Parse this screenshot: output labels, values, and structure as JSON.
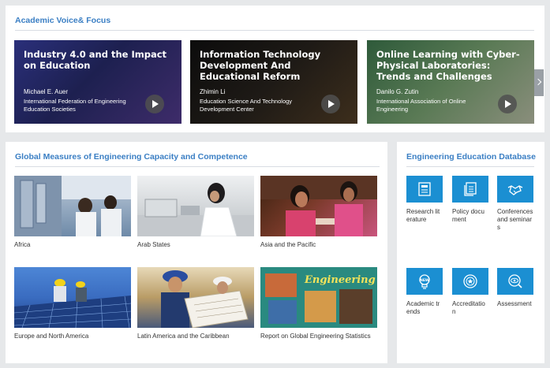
{
  "academic": {
    "title": "Academic Voice& Focus",
    "cards": [
      {
        "title": "Industry 4.0 and the Impact on Education",
        "author": "Michael E. Auer",
        "org": "International Federation of Engineering Education Societies"
      },
      {
        "title": "Information Technology Development And Educational Reform",
        "author": "Zhimin Li",
        "org": "Education Science And Technology Development Center"
      },
      {
        "title": "Online Learning with Cyber-Physical Laboratories: Trends and Challenges",
        "author": "Danilo G. Zutin",
        "org": "International Association of Online Engineering"
      }
    ]
  },
  "measures": {
    "title": "Global Measures of Engineering Capacity and Competence",
    "items": [
      {
        "label": "Africa"
      },
      {
        "label": "Arab States"
      },
      {
        "label": "Asia and the Pacific"
      },
      {
        "label": "Europe and North America"
      },
      {
        "label": "Latin America and the Caribbean"
      },
      {
        "label": "Report on Global Engineering Statistics"
      }
    ]
  },
  "database": {
    "title": "Engineering Education Database",
    "items": [
      {
        "label": "Research literature",
        "icon": "document-icon"
      },
      {
        "label": "Policy document",
        "icon": "files-icon"
      },
      {
        "label": "Conferences and seminars",
        "icon": "handshake-icon"
      },
      {
        "label": "Academic trends",
        "icon": "lightbulb-icon"
      },
      {
        "label": "Accreditation",
        "icon": "badge-icon"
      },
      {
        "label": "Assessment",
        "icon": "eye-icon"
      }
    ]
  },
  "colors": {
    "accent": "#3b7fc4",
    "tile": "#1b8fd2"
  }
}
